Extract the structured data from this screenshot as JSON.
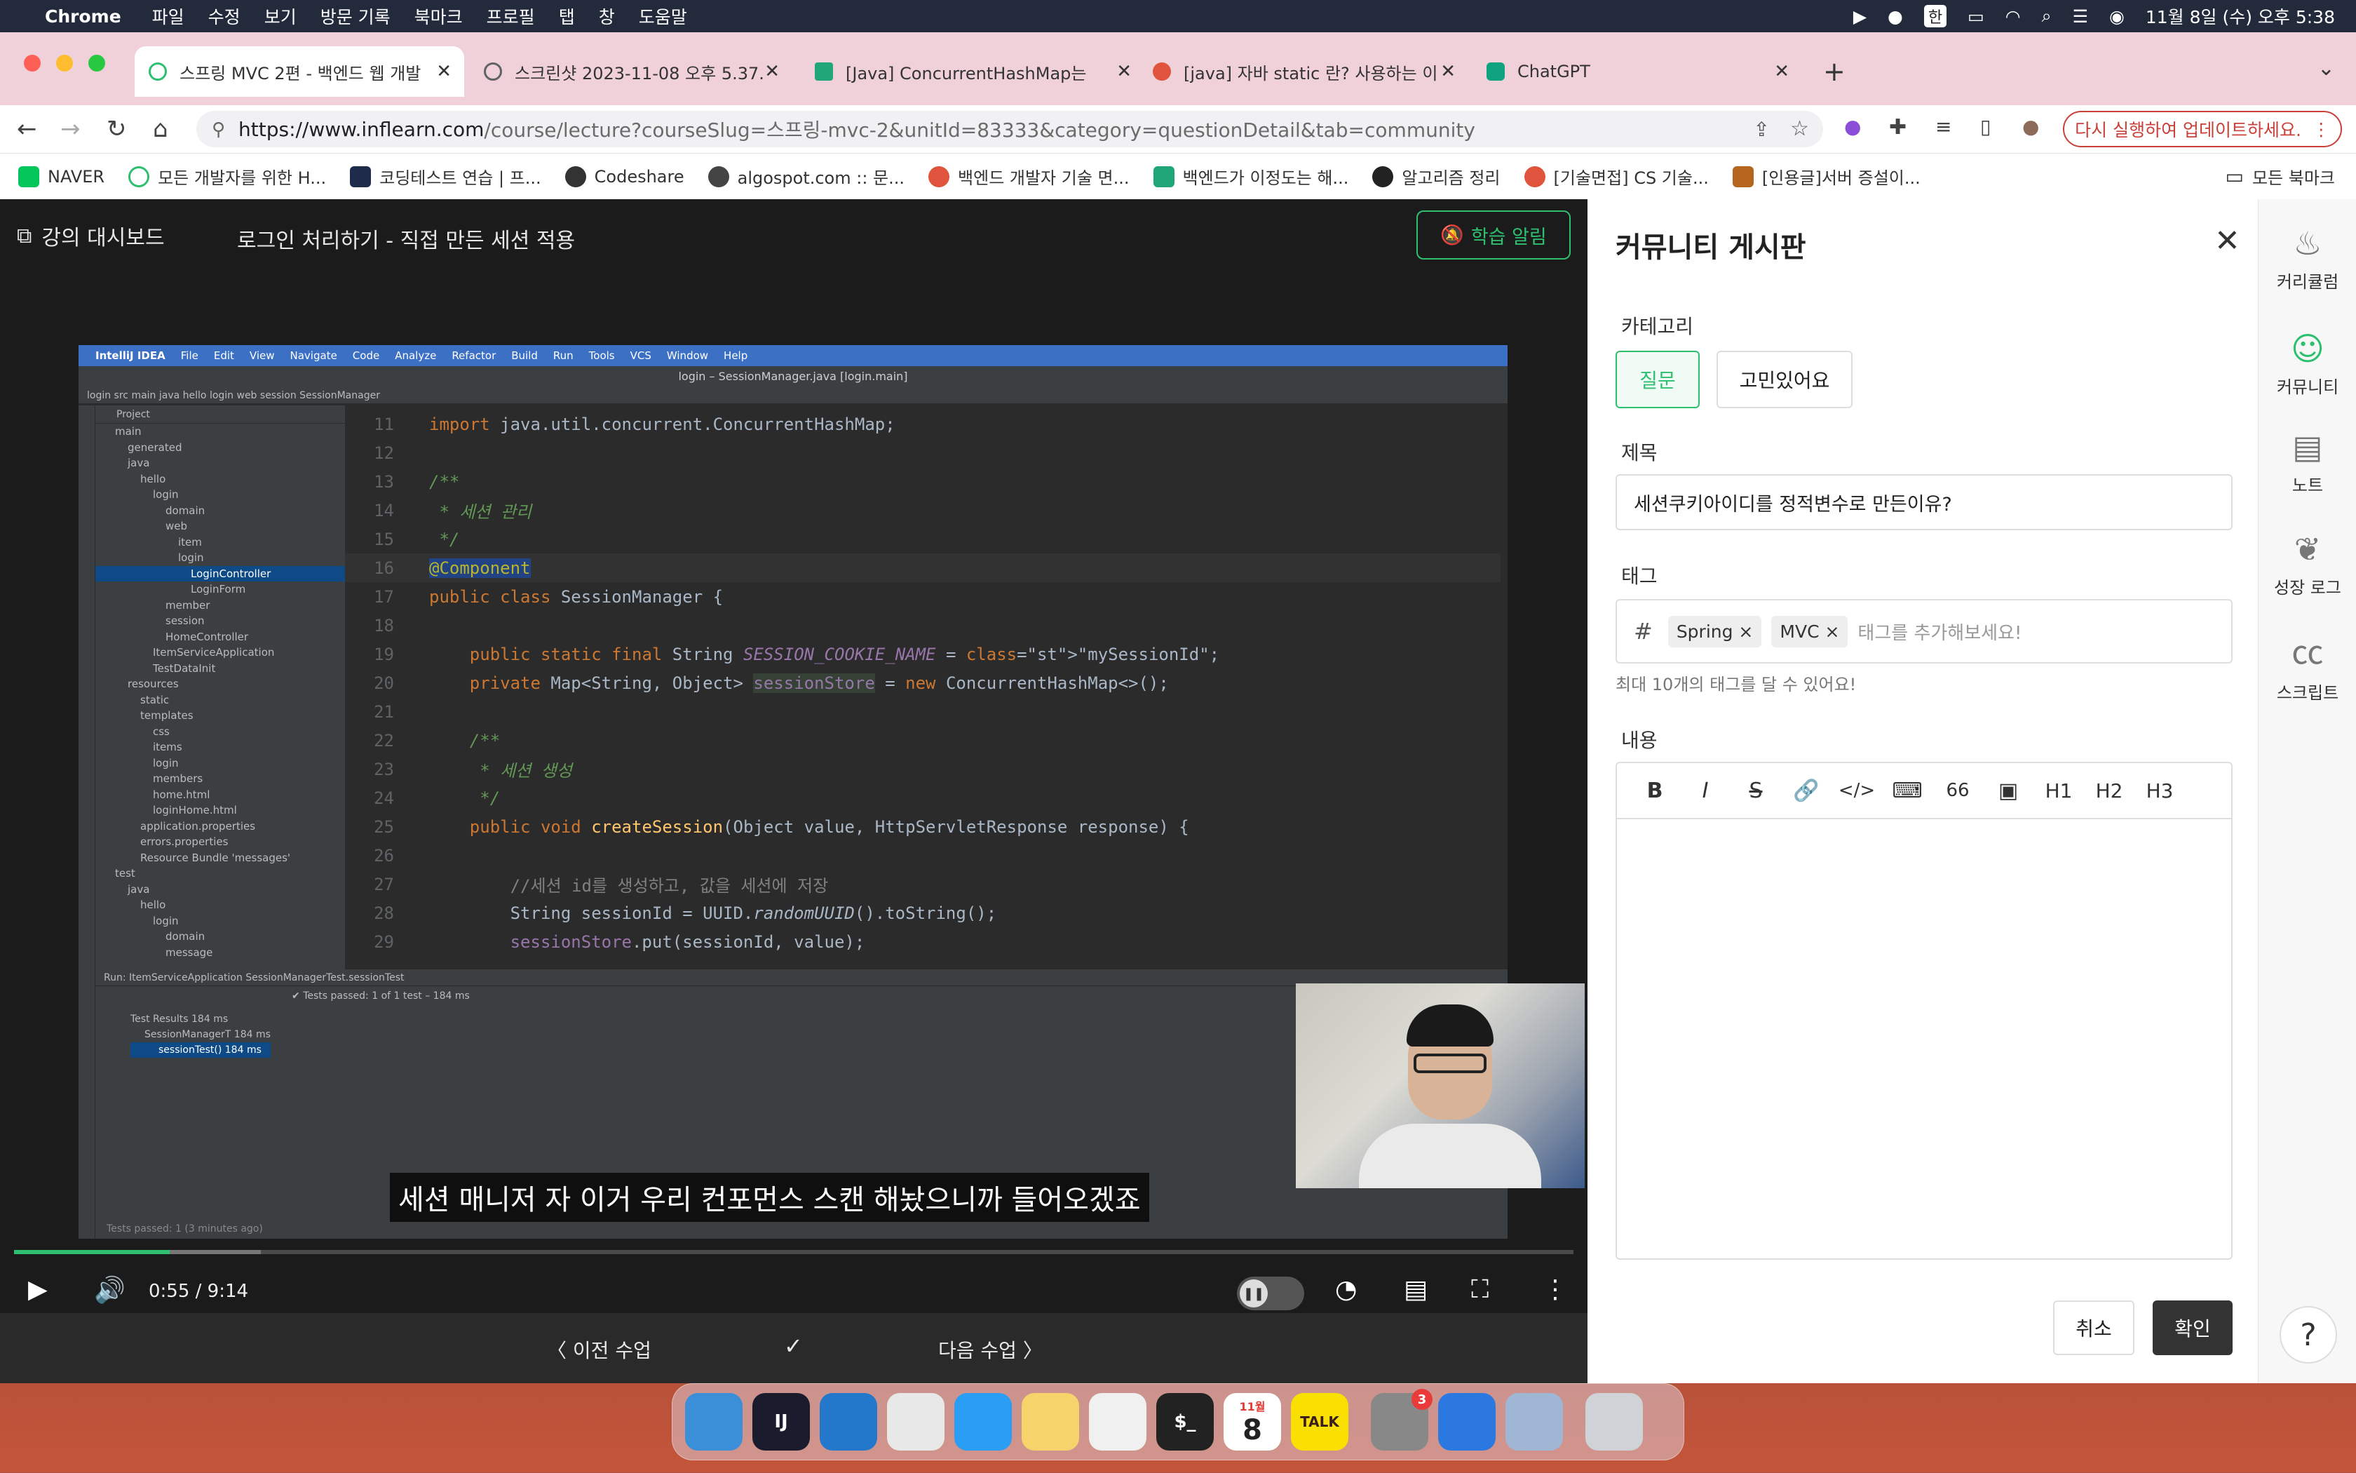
{
  "menubar": {
    "app": "Chrome",
    "items": [
      "파일",
      "수정",
      "보기",
      "방문 기록",
      "북마크",
      "프로필",
      "탭",
      "창",
      "도움말"
    ],
    "input_source": "한",
    "clock": "11월 8일 (수) 오후 5:38"
  },
  "tabs": [
    {
      "title": "스프링 MVC 2편 - 백엔드 웹 개발 ",
      "fav_color": "#2fbf71"
    },
    {
      "title": "스크린샷 2023-11-08 오후 5.37.",
      "fav_color": "#5f6368"
    },
    {
      "title": "[Java] ConcurrentHashMap는 ",
      "fav_color": "#21a67a"
    },
    {
      "title": "[java] 자바 static 란? 사용하는 이",
      "fav_color": "#e0533c"
    },
    {
      "title": "ChatGPT",
      "fav_color": "#10a37f"
    }
  ],
  "address": {
    "domain": "https://www.inflearn.com",
    "path": "/course/lecture?courseSlug=스프링-mvc-2&unitId=83333&category=questionDetail&tab=community"
  },
  "relaunch_label": "다시 실행하여 업데이트하세요.",
  "bookmarks": [
    {
      "label": "NAVER",
      "color": "#03c75a"
    },
    {
      "label": "모든 개발자를 위한 H...",
      "color": "#2fbf71"
    },
    {
      "label": "코딩테스트 연습 | 프...",
      "color": "#1e2b4a"
    },
    {
      "label": "Codeshare",
      "color": "#333333"
    },
    {
      "label": "algospot.com :: 문...",
      "color": "#444444"
    },
    {
      "label": "백엔드 개발자 기술 면...",
      "color": "#e0533c"
    },
    {
      "label": "백엔드가 이정도는 해...",
      "color": "#21a67a"
    },
    {
      "label": "알고리즘 정리",
      "color": "#222222"
    },
    {
      "label": "[기술면접] CS 기술...",
      "color": "#e0533c"
    },
    {
      "label": "[인용글]서버 증설이...",
      "color": "#b5651d"
    }
  ],
  "bookmarks_all": "모든 북마크",
  "player": {
    "dashboard": "강의 대시보드",
    "lecture_title": "로그인 처리하기 - 직접 만든 세션 적용",
    "alarm": "학습 알림",
    "subtitle": "세션 매니저 자 이거 우리 컨포먼스 스캔 해놨으니까 들어오겠죠",
    "time": "0:55 / 9:14",
    "progress_fraction": 0.1,
    "prev": "이전 수업",
    "next": "다음 수업"
  },
  "ide": {
    "menu": [
      "IntelliJ IDEA",
      "File",
      "Edit",
      "View",
      "Navigate",
      "Code",
      "Analyze",
      "Refactor",
      "Build",
      "Run",
      "Tools",
      "VCS",
      "Window",
      "Help"
    ],
    "window_title": "login – SessionManager.java [login.main]",
    "breadcrumb": "login  src  main  java  hello  login  web  session  SessionManager",
    "project_header": "Project",
    "tree": [
      "main",
      "generated",
      "java",
      "hello",
      "login",
      "domain",
      "web",
      "item",
      "login",
      "LoginController",
      "LoginForm",
      "member",
      "session",
      "HomeController",
      "ItemServiceApplication",
      "TestDataInit",
      "resources",
      "static",
      "templates",
      "css",
      "items",
      "login",
      "members",
      "home.html",
      "loginHome.html",
      "application.properties",
      "errors.properties",
      "Resource Bundle 'messages'",
      "test",
      "java",
      "hello",
      "login",
      "domain",
      "message"
    ],
    "lines": [
      {
        "n": "11",
        "code": "import java.util.concurrent.ConcurrentHashMap;"
      },
      {
        "n": "12",
        "code": ""
      },
      {
        "n": "13",
        "code": "/**"
      },
      {
        "n": "14",
        "code": " * 세션 관리"
      },
      {
        "n": "15",
        "code": " */"
      },
      {
        "n": "16",
        "code": "@Component"
      },
      {
        "n": "17",
        "code": "public class SessionManager {"
      },
      {
        "n": "18",
        "code": ""
      },
      {
        "n": "19",
        "code": "    public static final String SESSION_COOKIE_NAME = \"mySessionId\";"
      },
      {
        "n": "20",
        "code": "    private Map<String, Object> sessionStore = new ConcurrentHashMap<>();"
      },
      {
        "n": "21",
        "code": ""
      },
      {
        "n": "22",
        "code": "    /**"
      },
      {
        "n": "23",
        "code": "     * 세션 생성"
      },
      {
        "n": "24",
        "code": "     */"
      },
      {
        "n": "25",
        "code": "    public void createSession(Object value, HttpServletResponse response) {"
      },
      {
        "n": "26",
        "code": ""
      },
      {
        "n": "27",
        "code": "        //세션 id를 생성하고, 값을 세션에 저장"
      },
      {
        "n": "28",
        "code": "        String sessionId = UUID.randomUUID().toString();"
      },
      {
        "n": "29",
        "code": "        sessionStore.put(sessionId, value);"
      }
    ],
    "run_header": "Run:    ItemServiceApplication    SessionManagerTest.sessionTest",
    "run_status": "Tests passed: 1 of 1 test – 184 ms",
    "run_rows": [
      "Test Results  184 ms",
      "SessionManagerT 184 ms",
      "sessionTest()  184 ms"
    ],
    "footer": "Tests passed: 1 (3 minutes ago)"
  },
  "panel": {
    "title": "커뮤니티 게시판",
    "category_label": "카테고리",
    "category_selected": "질문",
    "category_other": "고민있어요",
    "title_label": "제목",
    "title_value": "세션쿠키아이디를 정적변수로 만든이유?",
    "tag_label": "태그",
    "tags": [
      "Spring ×",
      "MVC ×"
    ],
    "tag_placeholder": "태그를 추가해보세요!",
    "tag_help": "최대 10개의 태그를 달 수 있어요!",
    "content_label": "내용",
    "toolbar": [
      "B",
      "I",
      "S",
      "🔗",
      "</>",
      "⌨",
      "66",
      "▣",
      "H1",
      "H2",
      "H3"
    ],
    "cancel": "취소",
    "confirm": "확인"
  },
  "rail": [
    {
      "label": "커리큘럼",
      "icon": "curriculum-icon"
    },
    {
      "label": "커뮤니티",
      "icon": "community-icon"
    },
    {
      "label": "노트",
      "icon": "note-icon"
    },
    {
      "label": "성장 로그",
      "icon": "growth-icon"
    },
    {
      "label": "스크립트",
      "icon": "script-icon"
    }
  ],
  "dock": [
    {
      "label": "",
      "color": "#3b8fd9",
      "icon": "finder-icon"
    },
    {
      "label": "IJ",
      "color": "#1b1b2e",
      "icon": "intellij-icon"
    },
    {
      "label": "",
      "color": "#2478cc",
      "icon": "vscode-icon"
    },
    {
      "label": "",
      "color": "#e8e8e8",
      "icon": "chrome-icon"
    },
    {
      "label": "",
      "color": "#2a9df4",
      "icon": "safari-icon"
    },
    {
      "label": "",
      "color": "#f6d46b",
      "icon": "notes-icon"
    },
    {
      "label": "",
      "color": "#f0f0f0",
      "icon": "freeform-icon"
    },
    {
      "label": "$_",
      "color": "#222222",
      "icon": "terminal-icon"
    },
    {
      "label": "8",
      "color": "#ffffff",
      "icon": "calendar-icon"
    },
    {
      "label": "TALK",
      "color": "#f9e000",
      "icon": "kakaotalk-icon"
    },
    {
      "label": "",
      "color": "#888888",
      "icon": "settings-icon"
    },
    {
      "label": "",
      "color": "#2b79e0",
      "icon": "maps-icon"
    },
    {
      "label": "",
      "color": "#9fb7d4",
      "icon": "preview-icon"
    },
    {
      "label": "",
      "color": "#cfd3d8",
      "icon": "trash-icon"
    }
  ],
  "dock_badge": "3",
  "calendar_month": "11월"
}
